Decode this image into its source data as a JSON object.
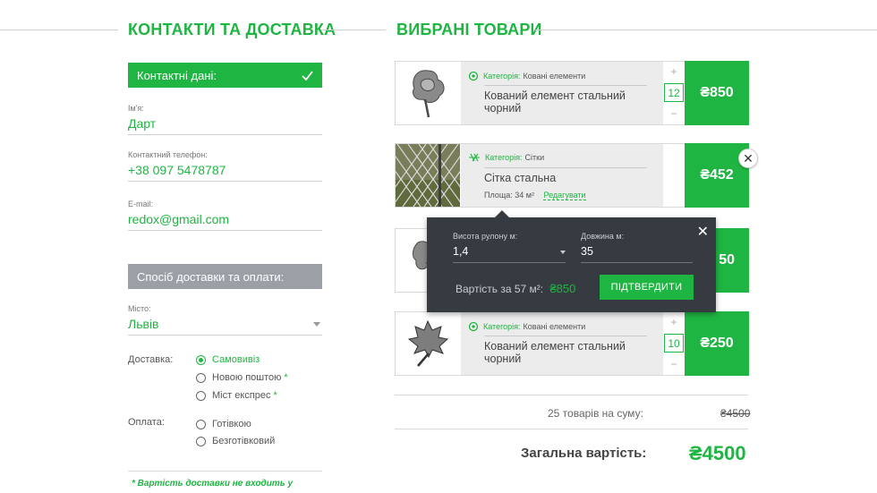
{
  "left": {
    "title": "КОНТАКТИ ТА ДОСТАВКА",
    "contact_header": "Контактні дані:",
    "fields": [
      {
        "label": "Ім'я:",
        "value": "Дарт"
      },
      {
        "label": "Контактний телефон:",
        "value": "+38 097 5478787"
      },
      {
        "label": "E-mail:",
        "value": "redox@gmail.com"
      }
    ],
    "delivery_header": "Спосіб доставки та оплати:",
    "city": {
      "label": "Місто:",
      "value": "Львів"
    },
    "delivery": {
      "label": "Доставка:",
      "options": [
        {
          "text": "Самовивіз",
          "selected": true,
          "star": ""
        },
        {
          "text": "Новою поштою",
          "selected": false,
          "star": "*"
        },
        {
          "text": "Міст експрес",
          "selected": false,
          "star": "*"
        }
      ]
    },
    "payment": {
      "label": "Оплата:",
      "options": [
        {
          "text": "Готівкою",
          "selected": false
        },
        {
          "text": "Безготівковий",
          "selected": false
        }
      ]
    },
    "note": "* Вартість доставки не входить у"
  },
  "right": {
    "title": "ВИБРАНІ ТОВАРИ",
    "products": [
      {
        "category_label": "Категорія:",
        "category": "Ковані елементи",
        "name": "Кований елемент стальний чорний",
        "qty": "12",
        "price": "₴850",
        "plus": "+",
        "minus": "−",
        "icon": "rose-icon"
      },
      {
        "category_label": "Категорія:",
        "category": "Сітки",
        "name": "Сітка стальна",
        "area_label": "Площа:",
        "area": "34 м²",
        "edit": "Редагувати",
        "price": "₴452",
        "icon": "mesh-icon"
      },
      {
        "price_partial": "50",
        "icon": "leaf-bracket-icon"
      },
      {
        "category_label": "Категорія:",
        "category": "Ковані елементи",
        "name": "Кований елемент стальний чорний",
        "qty": "10",
        "price": "₴250",
        "plus": "+",
        "minus": "−",
        "icon": "maple-leaf-icon"
      }
    ],
    "close_symbol": "✕",
    "popup": {
      "height_label": "Висота рулону м:",
      "height_value": "1,4",
      "length_label": "Довжина м:",
      "length_value": "35",
      "cost_label": "Вартість за 57 м²:",
      "cost_value": "₴850",
      "confirm": "ПІДТВЕРДИТИ",
      "close_symbol": "✕"
    },
    "summary": {
      "items_label": "25 товарів на суму:",
      "items_value": "₴4500",
      "total_label": "Загальна вартість:",
      "total_value": "₴4500"
    }
  },
  "colors": {
    "accent": "#1fb542",
    "gray_bar": "#9aa0a6",
    "popup_bg": "#363b41"
  }
}
